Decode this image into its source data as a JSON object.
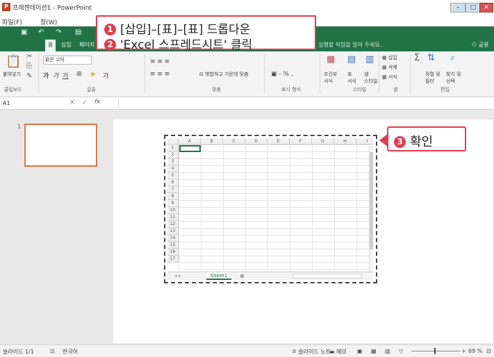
{
  "window": {
    "title": "프레젠테이션1 - PowerPoint",
    "app_icon": "P",
    "min": "–",
    "max": "□",
    "close": "✕"
  },
  "menu": {
    "file": "파일(F)",
    "window": "창(W)"
  },
  "tabs": {
    "home": "홈",
    "insert": "삽입",
    "page": "페이지",
    "tell_me": "실행할 작업을 알려 주세요.",
    "share": "공유"
  },
  "ribbon": {
    "paste": "붙여넣기",
    "font_name": "맑은 고딕",
    "merge_center": "병합하고 가운데 맞춤",
    "conditional": "조건부\n서식",
    "table_format": "표\n서식",
    "cell_style": "셀\n스타일",
    "insert": "삽입",
    "delete": "삭제",
    "format": "서식",
    "sort_filter": "정렬 및\n필터",
    "find_select": "찾기 및\n선택",
    "groups": {
      "clipboard": "클립보드",
      "font": "글꼴",
      "alignment": "맞춤",
      "number": "표시 형식",
      "styles": "스타일",
      "cells": "셀",
      "editing": "편집"
    }
  },
  "formula_bar": {
    "name_box": "A1",
    "fx": "fx"
  },
  "slides": {
    "number": "1"
  },
  "spreadsheet": {
    "columns": [
      "A",
      "B",
      "C",
      "D",
      "E",
      "F",
      "G",
      "H",
      "I"
    ],
    "rows": [
      "1",
      "2",
      "3",
      "4",
      "5",
      "6",
      "7",
      "8",
      "9",
      "10",
      "11",
      "12",
      "13",
      "14",
      "15",
      "16",
      "17"
    ],
    "sheet_tab": "Sheet1",
    "add_sheet": "⊕"
  },
  "callouts": {
    "step1_num": "1",
    "step1": "[삽입]–[표]–[표] 드롭다운",
    "step2_num": "2",
    "step2": "'Excel 스프레드시트' 클릭",
    "step3_num": "3",
    "step3": "확인"
  },
  "status": {
    "slide_count": "슬라이드 1/1",
    "language": "한국어",
    "notes": "슬라이드 노트",
    "comments": "메모",
    "zoom": "69 %"
  },
  "colors": {
    "ribbon_green": "#217346",
    "callout_red": "#e53a4d",
    "thumb_orange": "#e0763d"
  }
}
